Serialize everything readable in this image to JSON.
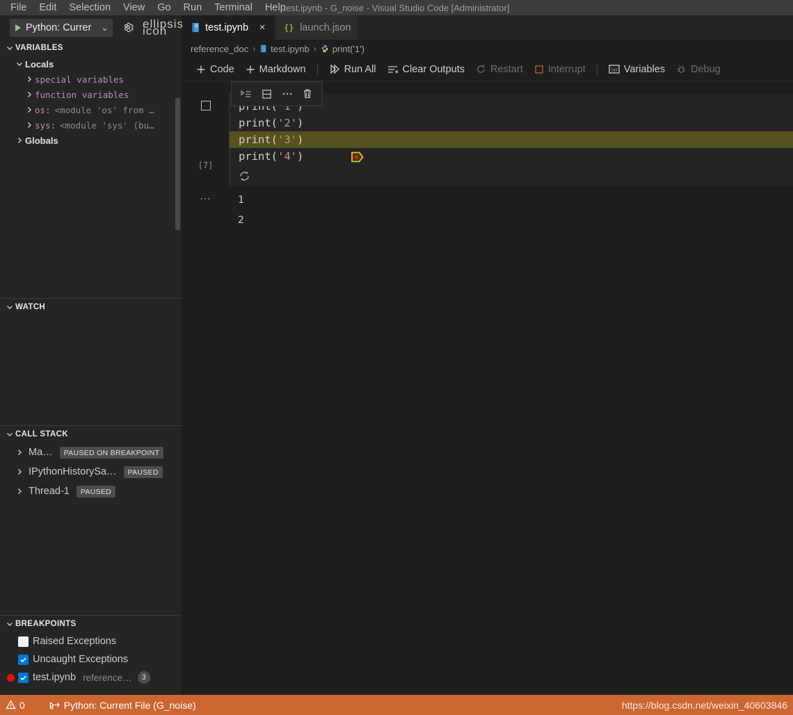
{
  "window": {
    "title": "test.ipynb - G_noise - Visual Studio Code [Administrator]",
    "menus": [
      "File",
      "Edit",
      "Selection",
      "View",
      "Go",
      "Run",
      "Terminal",
      "Help"
    ]
  },
  "debug_launch": {
    "play_icon": "play-icon",
    "config_label": "Python: Currer",
    "chevron": "⌄",
    "gear_icon": "gear-icon",
    "more_icon": "ellipsis-icon"
  },
  "sidebar": {
    "variables": {
      "title": "VARIABLES",
      "locals_label": "Locals",
      "globals_label": "Globals",
      "locals_items": [
        {
          "name": "special variables",
          "value": ""
        },
        {
          "name": "function variables",
          "value": ""
        },
        {
          "name": "os:",
          "value": "<module 'os' from …"
        },
        {
          "name": "sys:",
          "value": "<module 'sys' (bu…"
        }
      ]
    },
    "watch": {
      "title": "WATCH"
    },
    "callstack": {
      "title": "CALL STACK",
      "frames": [
        {
          "label": "Ma…",
          "badge": "PAUSED ON BREAKPOINT"
        },
        {
          "label": "IPythonHistorySa…",
          "badge": "PAUSED"
        },
        {
          "label": "Thread-1",
          "badge": "PAUSED"
        }
      ]
    },
    "breakpoints": {
      "title": "BREAKPOINTS",
      "items": [
        {
          "label": "Raised Exceptions",
          "checked": false,
          "dot": false,
          "sub": "",
          "count": ""
        },
        {
          "label": "Uncaught Exceptions",
          "checked": true,
          "dot": false,
          "sub": "",
          "count": ""
        },
        {
          "label": "test.ipynb",
          "checked": true,
          "dot": true,
          "sub": "reference…",
          "count": "3"
        }
      ]
    }
  },
  "tabs": [
    {
      "label": "test.ipynb",
      "icon": "notebook-icon",
      "active": true,
      "close": "×"
    },
    {
      "label": "launch.json",
      "icon": "json-braces-icon",
      "active": false,
      "close": ""
    }
  ],
  "breadcrumb": {
    "items": [
      "reference_doc",
      "test.ipynb",
      "print('1')"
    ],
    "separator": "›"
  },
  "notebook_toolbar": {
    "buttons": [
      {
        "label": "Code",
        "icon": "plus-icon",
        "enabled": true
      },
      {
        "label": "Markdown",
        "icon": "plus-icon",
        "enabled": true
      },
      {
        "label": "Run All",
        "icon": "run-all-icon",
        "enabled": true
      },
      {
        "label": "Clear Outputs",
        "icon": "clear-outputs-icon",
        "enabled": true
      },
      {
        "label": "Restart",
        "icon": "restart-icon",
        "enabled": false
      },
      {
        "label": "Interrupt",
        "icon": "interrupt-icon",
        "enabled": false
      },
      {
        "label": "Variables",
        "icon": "variables-icon",
        "enabled": true
      },
      {
        "label": "Debug",
        "icon": "bug-icon",
        "enabled": false
      }
    ]
  },
  "cell_toolbar": {
    "buttons": [
      "run-by-line-icon",
      "split-cell-icon",
      "more-actions-icon",
      "delete-cell-icon"
    ]
  },
  "cell": {
    "execution_count": "[7]",
    "run_icon": "stop-square-icon",
    "sync_icon": "sync-icon",
    "lines": [
      {
        "fn": "print",
        "arg": "'1'",
        "breakpoint": false,
        "highlight": false
      },
      {
        "fn": "print",
        "arg": "'2'",
        "breakpoint": false,
        "highlight": false
      },
      {
        "fn": "print",
        "arg": "'3'",
        "breakpoint": true,
        "highlight": true
      },
      {
        "fn": "print",
        "arg": "'4'",
        "breakpoint": false,
        "highlight": false
      }
    ],
    "output_prefix": "…",
    "output_lines": [
      "1",
      "2"
    ]
  },
  "debug_toolbar": {
    "grip_icon": "drag-grip-icon",
    "buttons": [
      {
        "icon": "continue-icon",
        "color": "#75beff"
      },
      {
        "icon": "step-over-icon",
        "color": "#75beff"
      },
      {
        "icon": "step-into-icon",
        "color": "#75beff"
      },
      {
        "icon": "step-out-icon",
        "color": "#75beff"
      },
      {
        "icon": "restart-debug-icon",
        "color": "#89d185"
      },
      {
        "icon": "disconnect-icon",
        "color": "#f48771"
      }
    ]
  },
  "statusbar": {
    "warnings_icon": "warning-icon",
    "warnings_count": "0",
    "debug_icon": "debug-alt-icon",
    "debug_text": "Python: Current File (G_noise)",
    "watermark": "https://blog.csdn.net/weixin_40603846",
    "background": "#cc6633"
  }
}
